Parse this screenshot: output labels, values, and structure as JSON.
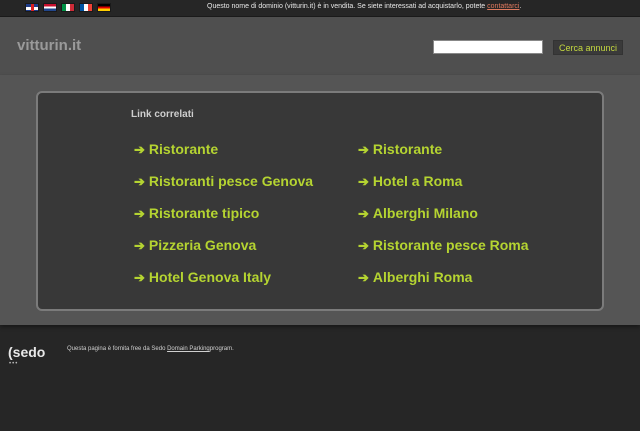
{
  "topbar": {
    "flags": [
      {
        "name": "uk-flag-icon",
        "color": "#1f3d8a"
      },
      {
        "name": "nl-flag-icon",
        "color": "#21468b"
      },
      {
        "name": "it-flag-icon",
        "color": "#009246"
      },
      {
        "name": "fr-flag-icon",
        "color": "#0055a4"
      },
      {
        "name": "de-flag-icon",
        "color": "#dd0000"
      }
    ],
    "notice_text": "Questo nome di dominio (vitturin.it) è in vendita. Se siete interessati ad acquistarlo, potete ",
    "notice_link": "contattarci",
    "notice_end": "."
  },
  "header": {
    "logo": "vitturin.it",
    "search_value": "",
    "search_button": "Cerca annunci"
  },
  "panel": {
    "title": "Link correlati",
    "arrow": "➔",
    "left_links": [
      "Ristorante",
      "Ristoranti pesce Genova",
      "Ristorante tipico",
      "Pizzeria Genova",
      "Hotel Genova Italy"
    ],
    "right_links": [
      "Ristorante",
      "Hotel a Roma",
      "Alberghi Milano",
      "Ristorante pesce Roma",
      "Alberghi Roma"
    ]
  },
  "footer": {
    "logo": "(sedo",
    "logo_dots": "•••",
    "text_before": "Questa pagina è fornita free da Sedo ",
    "link": "Domain Parking",
    "text_after": "program."
  },
  "colors": {
    "link": "#b5d431",
    "header_bg": "#4f4f4f",
    "band_bg": "#555555",
    "panel_bg": "#383838",
    "page_bg": "#262626"
  }
}
